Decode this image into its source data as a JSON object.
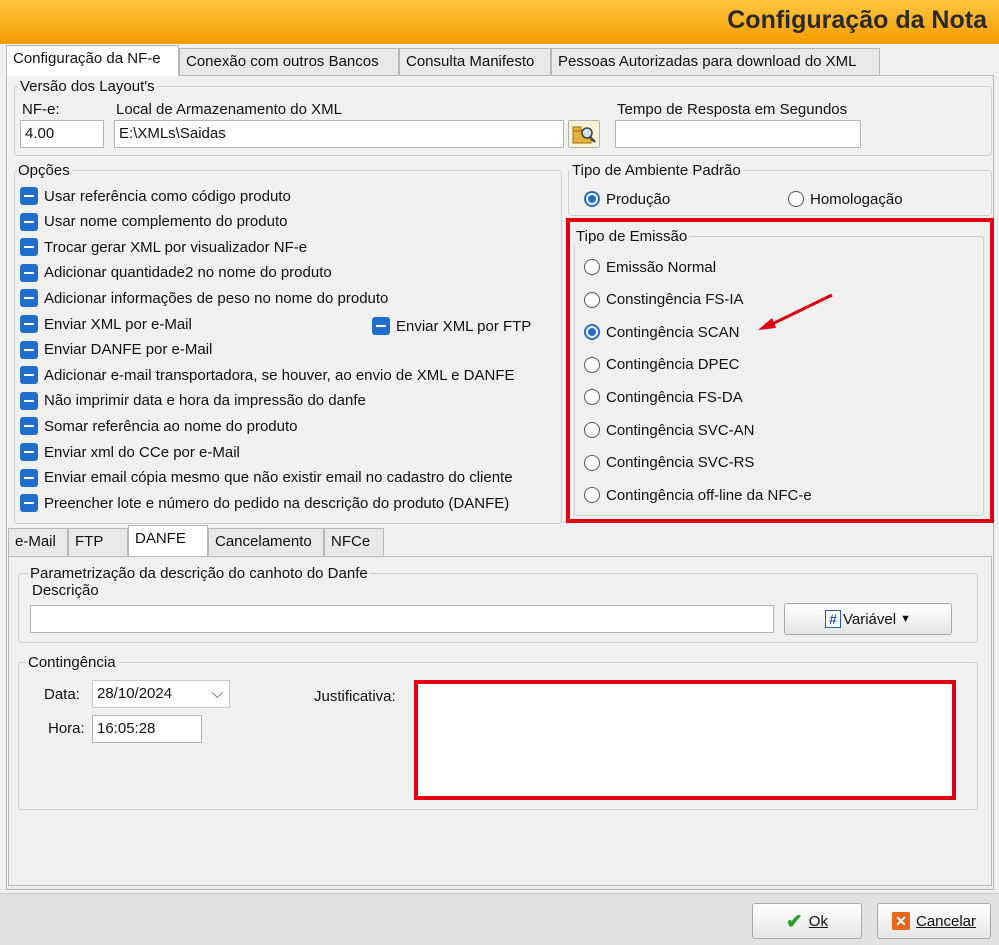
{
  "window": {
    "title": "Configuração da Nota"
  },
  "main_tabs": [
    "Configuração da NF-e",
    "Conexão com outros Bancos",
    "Consulta Manifesto",
    "Pessoas Autorizadas para download do XML"
  ],
  "layout_versions": {
    "legend": "Versão dos Layout's",
    "nfe_label": "NF-e:",
    "nfe_value": "4.00",
    "storage_label": "Local de Armazenamento do XML",
    "storage_value": "E:\\XMLs\\Saidas",
    "response_time_label": "Tempo de Resposta em Segundos",
    "response_time_value": ""
  },
  "options": {
    "legend": "Opções",
    "items": [
      "Usar referência como código produto",
      "Usar nome complemento do produto",
      "Trocar gerar XML por visualizador NF-e",
      "Adicionar quantidade2 no nome do produto",
      "Adicionar informações de peso no nome do produto",
      "Enviar XML por e-Mail",
      "Enviar DANFE por e-Mail",
      "Adicionar e-mail transportadora, se houver, ao envio de XML e DANFE",
      "Não imprimir data e hora da impressão do danfe",
      "Somar referência ao nome do produto",
      "Enviar xml do CCe por e-Mail",
      "Enviar email cópia mesmo que não existir email no cadastro do cliente",
      "Preencher lote e número do pedido na descrição do produto (DANFE)"
    ],
    "ftp_item": "Enviar XML por FTP"
  },
  "environment": {
    "legend": "Tipo de Ambiente Padrão",
    "production": "Produção",
    "homologation": "Homologação",
    "selected": "Produção"
  },
  "emission": {
    "legend": "Tipo de Emissão",
    "options": [
      "Emissão Normal",
      "Constingência FS-IA",
      "Contingência SCAN",
      "Contingência DPEC",
      "Contingência FS-DA",
      "Contingência SVC-AN",
      "Contingência SVC-RS",
      "Contingência off-line da NFC-e"
    ],
    "selected_index": 2
  },
  "sub_tabs": [
    "e-Mail",
    "FTP",
    "DANFE",
    "Cancelamento",
    "NFCe"
  ],
  "danfe": {
    "legend": "Parametrização da descrição do canhoto do Danfe",
    "description_label": "Descrição",
    "description_value": "",
    "variable_button": "Variável"
  },
  "contingency": {
    "legend": "Contingência",
    "date_label": "Data:",
    "date_value": "28/10/2024",
    "time_label": "Hora:",
    "time_value": "16:05:28",
    "justification_label": "Justificativa:",
    "justification_value": ""
  },
  "footer": {
    "ok": "Ok",
    "cancel": "Cancelar"
  },
  "colors": {
    "header_top": "#ffc640",
    "header_bottom": "#f59c00",
    "checkbox": "#1f6ecc",
    "highlight": "#e00012"
  }
}
